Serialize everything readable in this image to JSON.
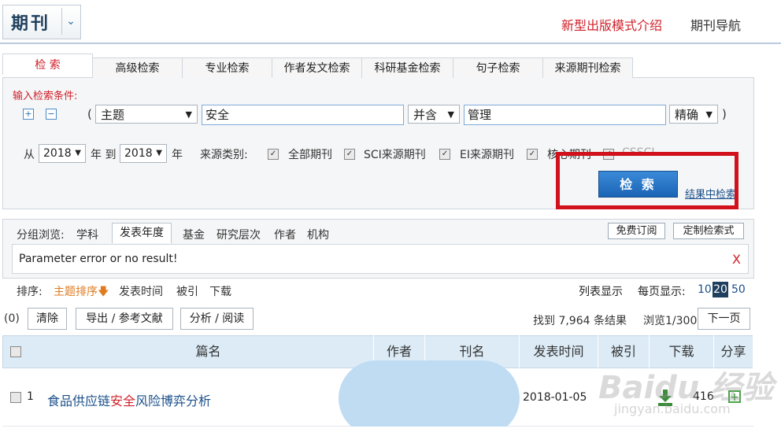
{
  "header": {
    "logo": "期刊",
    "links": [
      "新型出版模式介绍",
      "期刊导航"
    ]
  },
  "tabs": [
    "检 索",
    "高级检索",
    "专业检索",
    "作者发文检索",
    "科研基金检索",
    "句子检索",
    "来源期刊检索"
  ],
  "search": {
    "condition_label": "输入检索条件:",
    "plus": "+",
    "minus": "−",
    "open_paren": "(",
    "close_paren": ")",
    "field": "主题",
    "term1": "安全",
    "logic": "并含",
    "term2": "管理",
    "match": "精确",
    "from_label": "从",
    "year_from": "2018",
    "year_to_label": "年 到",
    "year_to": "2018",
    "year_label": "年",
    "source_label": "来源类别:",
    "sources": [
      "全部期刊",
      "SCI来源期刊",
      "EI来源期刊",
      "核心期刊",
      "CSSCI"
    ],
    "search_button": "检 索",
    "in_result": "结果中检索"
  },
  "group": {
    "label": "分组浏览:",
    "items": [
      "学科",
      "发表年度",
      "基金",
      "研究层次",
      "作者",
      "机构"
    ],
    "free_sub": "免费订阅",
    "custom": "定制检索式",
    "message": "Parameter error or no result!",
    "close": "X"
  },
  "sort": {
    "label": "排序:",
    "items": [
      "主题排序",
      "发表时间",
      "被引",
      "下载"
    ],
    "list_view": "列表显示",
    "per_page_label": "每页显示:",
    "per_page": [
      "10",
      "20",
      "50"
    ]
  },
  "toolbar": {
    "count": "(0)",
    "clear": "清除",
    "export": "导出 / 参考文献",
    "analyze": "分析 / 阅读",
    "found": "找到 7,964 条结果",
    "browse": "浏览1/300",
    "next": "下一页"
  },
  "table": {
    "columns": [
      "篇名",
      "作者",
      "刊名",
      "发表时间",
      "被引",
      "下载",
      "分享"
    ],
    "rows": [
      {
        "num": "1",
        "title_pre": "食品供应链",
        "title_hl": "安全",
        "title_post": "风险博弈分析",
        "date": "2018-01-05",
        "downloads": "416"
      }
    ]
  },
  "watermark": "Baidu 经验",
  "watermark_sub": "jingyan.baidu.com",
  "colors": {
    "accent": "#d0202a",
    "brand": "#1f3f5e",
    "button": "#1b64b5"
  }
}
